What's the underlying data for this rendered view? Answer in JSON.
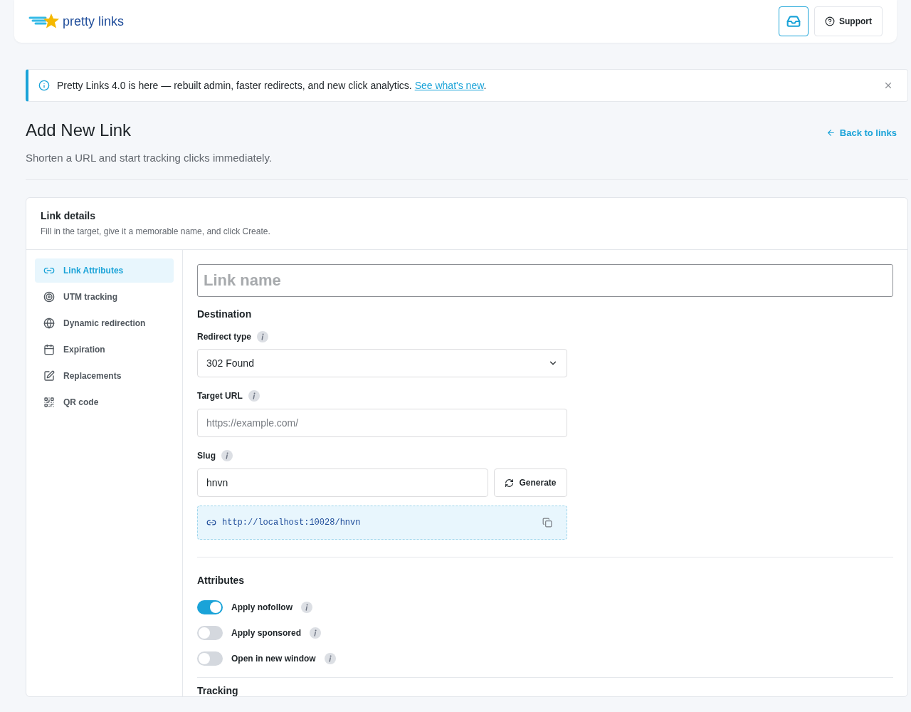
{
  "header": {
    "logo_text": "pretty links",
    "buttons": [
      {
        "kind": "icon"
      },
      {
        "kind": "text",
        "label": "Support"
      }
    ]
  },
  "notice": {
    "text": "Pretty Links 4.0 is here — rebuilt admin, faster redirects, and new click analytics.",
    "link": "See what's new",
    "suffix": "."
  },
  "page": {
    "title": "Add New Link",
    "subtitle": "Shorten a URL and start tracking clicks immediately.",
    "back_link": "Back to links"
  },
  "card": {
    "title": "Link details",
    "subtitle": "Fill in the target, give it a memorable name, and click Create."
  },
  "sidebar": {
    "items": [
      {
        "label": "Link Attributes",
        "selected": true
      },
      {
        "label": "UTM tracking",
        "selected": false
      },
      {
        "label": "Dynamic redirection",
        "selected": false
      },
      {
        "label": "Expiration",
        "selected": false
      },
      {
        "label": "Replacements",
        "selected": false
      },
      {
        "label": "QR code",
        "selected": false
      }
    ]
  },
  "form": {
    "name_placeholder": "Link name",
    "destination_heading": "Destination",
    "redirect_type": {
      "label": "Redirect type",
      "value": "302 Found"
    },
    "target_url": {
      "label": "Target URL",
      "placeholder": "https://example.com/"
    },
    "slug": {
      "label": "Slug",
      "value": "hnvn",
      "button": "Generate"
    },
    "preview_url": "http://localhost:10028/hnvn",
    "attributes_heading": "Attributes",
    "attributes": [
      {
        "label": "Apply nofollow",
        "on": true
      },
      {
        "label": "Apply sponsored",
        "on": false
      },
      {
        "label": "Open in new window",
        "on": false
      }
    ],
    "tracking_heading": "Tracking"
  }
}
